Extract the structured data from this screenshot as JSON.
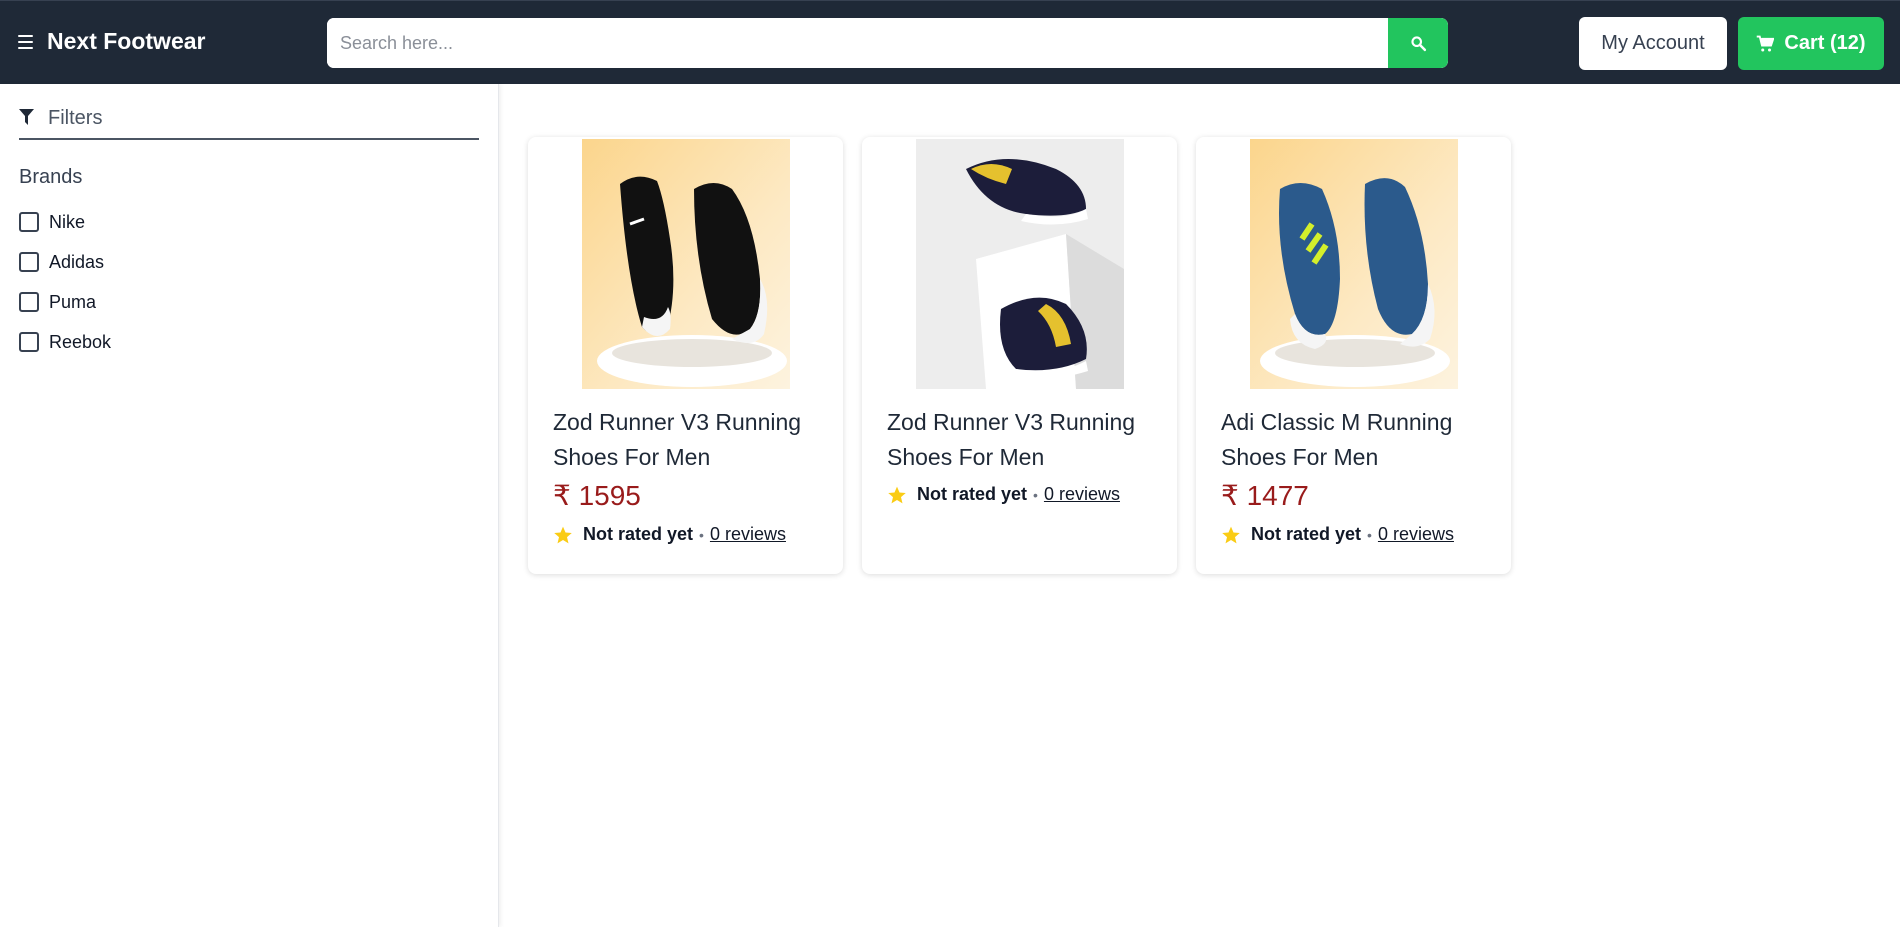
{
  "header": {
    "brand": "Next Footwear",
    "search_placeholder": "Search here...",
    "account_label": "My Account",
    "cart_label": "Cart (12)"
  },
  "sidebar": {
    "filters_label": "Filters",
    "brands_title": "Brands",
    "brands": [
      {
        "label": "Nike",
        "checked": false
      },
      {
        "label": "Adidas",
        "checked": false
      },
      {
        "label": "Puma",
        "checked": false
      },
      {
        "label": "Reebok",
        "checked": false
      }
    ]
  },
  "products": [
    {
      "title": "Zod Runner V3 Running Shoes For Men",
      "price": "₹ 1595",
      "rating": "Not rated yet",
      "reviews": "0 reviews"
    },
    {
      "title": "Zod Runner V3 Running Shoes For Men",
      "price": "",
      "rating": "Not rated yet",
      "reviews": "0 reviews"
    },
    {
      "title": "Adi Classic M Running Shoes For Men",
      "price": "₹ 1477",
      "rating": "Not rated yet",
      "reviews": "0 reviews"
    }
  ],
  "colors": {
    "topbar": "#1f2937",
    "accent_green": "#22c55e",
    "price_red": "#991b1b",
    "star_yellow": "#facc15"
  },
  "icons": [
    "menu-icon",
    "search-icon",
    "cart-icon",
    "filter-icon",
    "star-icon"
  ]
}
